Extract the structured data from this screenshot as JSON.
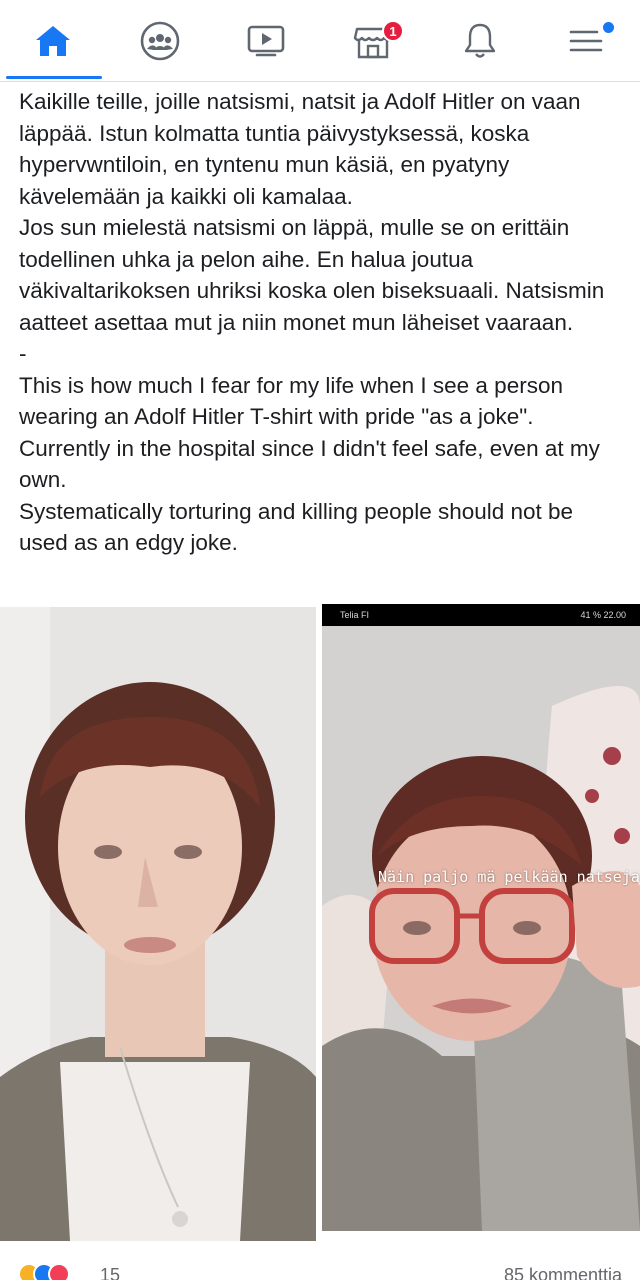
{
  "nav": {
    "items": [
      {
        "name": "home",
        "icon": "home-icon",
        "active": true
      },
      {
        "name": "groups",
        "icon": "groups-icon"
      },
      {
        "name": "watch",
        "icon": "video-icon"
      },
      {
        "name": "marketplace",
        "icon": "marketplace-icon",
        "badge": "1"
      },
      {
        "name": "notifications",
        "icon": "bell-icon"
      },
      {
        "name": "menu",
        "icon": "menu-icon",
        "dot": true
      }
    ],
    "accent": "#1877f2",
    "badge_color": "#e41e3f"
  },
  "post": {
    "finnish_1": "Kaikille teille, joille natsismi, natsit ja Adolf Hitler on vaan läppää. Istun kolmatta tuntia päivystyksessä, koska hypervwntiloin, en tyntenu mun käsiä, en pyatyny kävelemään ja kaikki oli kamalaa.",
    "finnish_2": "Jos sun mielestä natsismi on läppä, mulle se on erittäin todellinen uhka ja pelon aihe. En halua joutua väkivaltarikoksen uhriksi koska olen biseksuaali. Natsismin aatteet asettaa mut ja niin monet mun läheiset vaaraan.",
    "separator": "-",
    "english_1": "This is how much I fear for my life when I see a person wearing an Adolf Hitler T-shirt with pride \"as a joke\". Currently in the hospital since I didn't feel safe, even at my own.",
    "english_2": "Systematically torturing and killing people should not be used as an edgy joke."
  },
  "photo_right": {
    "status_left": "Telia FI",
    "status_right": "41 %  22.00",
    "caption": "Näin paljo mä pelkään natseja"
  },
  "footer": {
    "reaction_count": "15",
    "comments": "85 kommenttia"
  }
}
